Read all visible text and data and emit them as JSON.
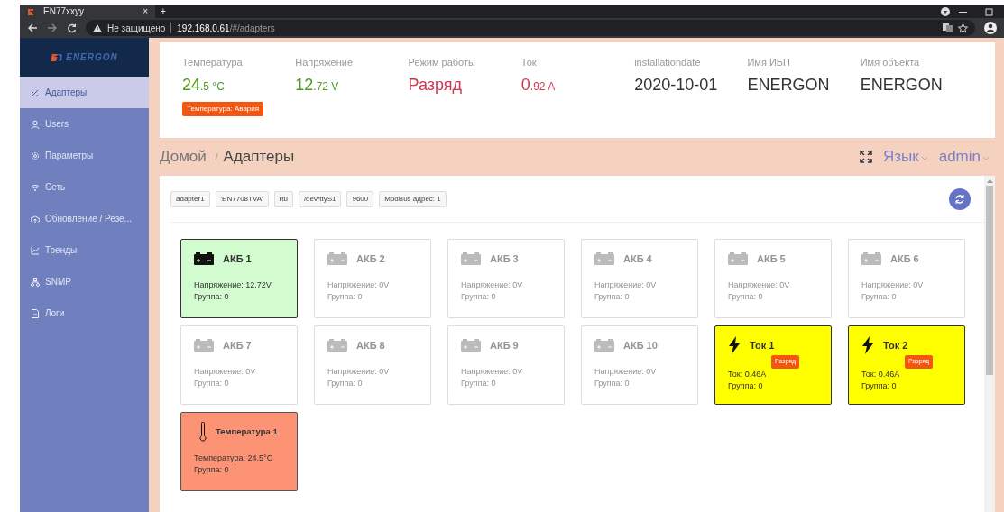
{
  "browser": {
    "tab_title": "EN77xxyy",
    "tab_close": "×",
    "new_tab": "+",
    "security": "Не защищено",
    "url_host": "192.168.0.61",
    "url_path": "/#/adapters"
  },
  "sidebar": {
    "logo": "ENERGON",
    "items": [
      {
        "label": "Адаптеры",
        "selected": true
      },
      {
        "label": "Users",
        "selected": false
      },
      {
        "label": "Параметры",
        "selected": false
      },
      {
        "label": "Сеть",
        "selected": false
      },
      {
        "label": "Обновление / Резе...",
        "selected": false
      },
      {
        "label": "Тренды",
        "selected": false
      },
      {
        "label": "SNMP",
        "selected": false
      },
      {
        "label": "Логи",
        "selected": false
      }
    ]
  },
  "stats": [
    {
      "label": "Температура",
      "value": "24",
      "unit": ".5 °C",
      "color": "#4f9a1f"
    },
    {
      "label": "Напряжение",
      "value": "12",
      "unit": ".72 V",
      "color": "#4f9a1f"
    },
    {
      "label": "Режим работы",
      "value": "Разряд",
      "color": "#d0384f"
    },
    {
      "label": "Ток",
      "value": "0",
      "unit": ".92 A",
      "color": "#d0384f"
    },
    {
      "label": "installationdate",
      "value": "2020-10-01",
      "color": "#333333"
    },
    {
      "label": "Имя ИБП",
      "value": "ENERGON",
      "color": "#333333"
    },
    {
      "label": "Имя объекта",
      "value": "ENERGON",
      "color": "#333333"
    }
  ],
  "alert": "Температура: Авария",
  "breadcrumb": {
    "home": "Домой",
    "separator": "/",
    "current": "Адаптеры"
  },
  "header_menu": {
    "language": "Язык",
    "user": "admin"
  },
  "adapter_tags": [
    "adapter1",
    "'EN7708TVA'",
    "rtu",
    "/dev/ttyS1",
    "9600",
    "ModBus адрес: 1"
  ],
  "cards": [
    {
      "kind": "battery",
      "active": true,
      "title": "АКБ 1",
      "lines": [
        "Напряжение: 12.72V",
        "Группа: 0"
      ]
    },
    {
      "kind": "battery",
      "active": false,
      "title": "АКБ 2",
      "lines": [
        "Напряжение: 0V",
        "Группа: 0"
      ]
    },
    {
      "kind": "battery",
      "active": false,
      "title": "АКБ 3",
      "lines": [
        "Напряжение: 0V",
        "Группа: 0"
      ]
    },
    {
      "kind": "battery",
      "active": false,
      "title": "АКБ 4",
      "lines": [
        "Напряжение: 0V",
        "Группа: 0"
      ]
    },
    {
      "kind": "battery",
      "active": false,
      "title": "АКБ 5",
      "lines": [
        "Напряжение: 0V",
        "Группа: 0"
      ]
    },
    {
      "kind": "battery",
      "active": false,
      "title": "АКБ 6",
      "lines": [
        "Напряжение: 0V",
        "Группа: 0"
      ]
    },
    {
      "kind": "battery",
      "active": false,
      "title": "АКБ 7",
      "lines": [
        "Напряжение: 0V",
        "Группа: 0"
      ]
    },
    {
      "kind": "battery",
      "active": false,
      "title": "АКБ 8",
      "lines": [
        "Напряжение: 0V",
        "Группа: 0"
      ]
    },
    {
      "kind": "battery",
      "active": false,
      "title": "АКБ 9",
      "lines": [
        "Напряжение: 0V",
        "Группа: 0"
      ]
    },
    {
      "kind": "battery",
      "active": false,
      "title": "АКБ 10",
      "lines": [
        "Напряжение: 0V",
        "Группа: 0"
      ]
    },
    {
      "kind": "current",
      "active": true,
      "title": "Ток 1",
      "badge": "Разряд",
      "lines": [
        "Ток: 0.46A",
        "Группа: 0"
      ]
    },
    {
      "kind": "current",
      "active": true,
      "title": "Ток 2",
      "badge": "Разряд",
      "lines": [
        "Ток: 0.46A",
        "Группа: 0"
      ]
    },
    {
      "kind": "temperature",
      "active": true,
      "title": "Температура 1",
      "lines": [
        "Температура: 24.5°C",
        "Группа: 0"
      ]
    }
  ]
}
